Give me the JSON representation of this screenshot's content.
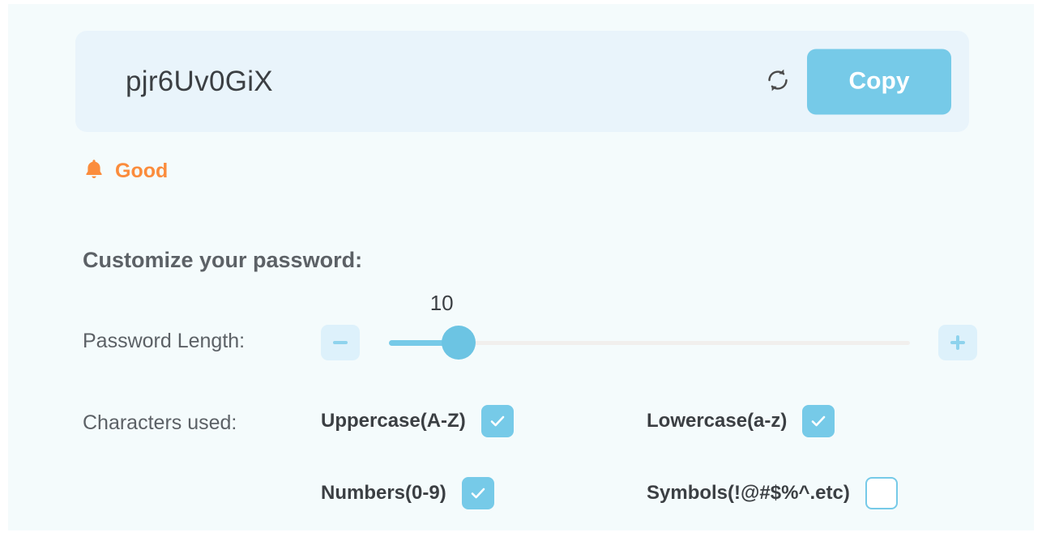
{
  "theme": {
    "accent": "#76cae8",
    "accent_soft": "#ddf1fb",
    "card_bg": "#f4fbfc",
    "field_bg": "#e9f4fb",
    "warning": "#fb8c3c",
    "text_dark": "#3b3f43",
    "text_muted": "#5c6166",
    "track_bg": "#f1efed"
  },
  "password": {
    "value": "pjr6Uv0GiX",
    "refresh_icon": "refresh-icon",
    "copy_label": "Copy"
  },
  "strength": {
    "icon": "bell-icon",
    "label": "Good"
  },
  "customize": {
    "heading": "Customize your password:",
    "length": {
      "label": "Password Length:",
      "value": "10",
      "value_number": 10,
      "min": 4,
      "max": 64,
      "fill_percent": 13.4,
      "decrement_icon": "minus-icon",
      "increment_icon": "plus-icon"
    },
    "characters": {
      "label": "Characters used:",
      "options": [
        {
          "label": "Uppercase(A-Z)",
          "checked": true,
          "name": "uppercase"
        },
        {
          "label": "Lowercase(a-z)",
          "checked": true,
          "name": "lowercase"
        },
        {
          "label": "Numbers(0-9)",
          "checked": true,
          "name": "numbers"
        },
        {
          "label": "Symbols(!@#$%^.etc)",
          "checked": false,
          "name": "symbols"
        }
      ]
    }
  }
}
